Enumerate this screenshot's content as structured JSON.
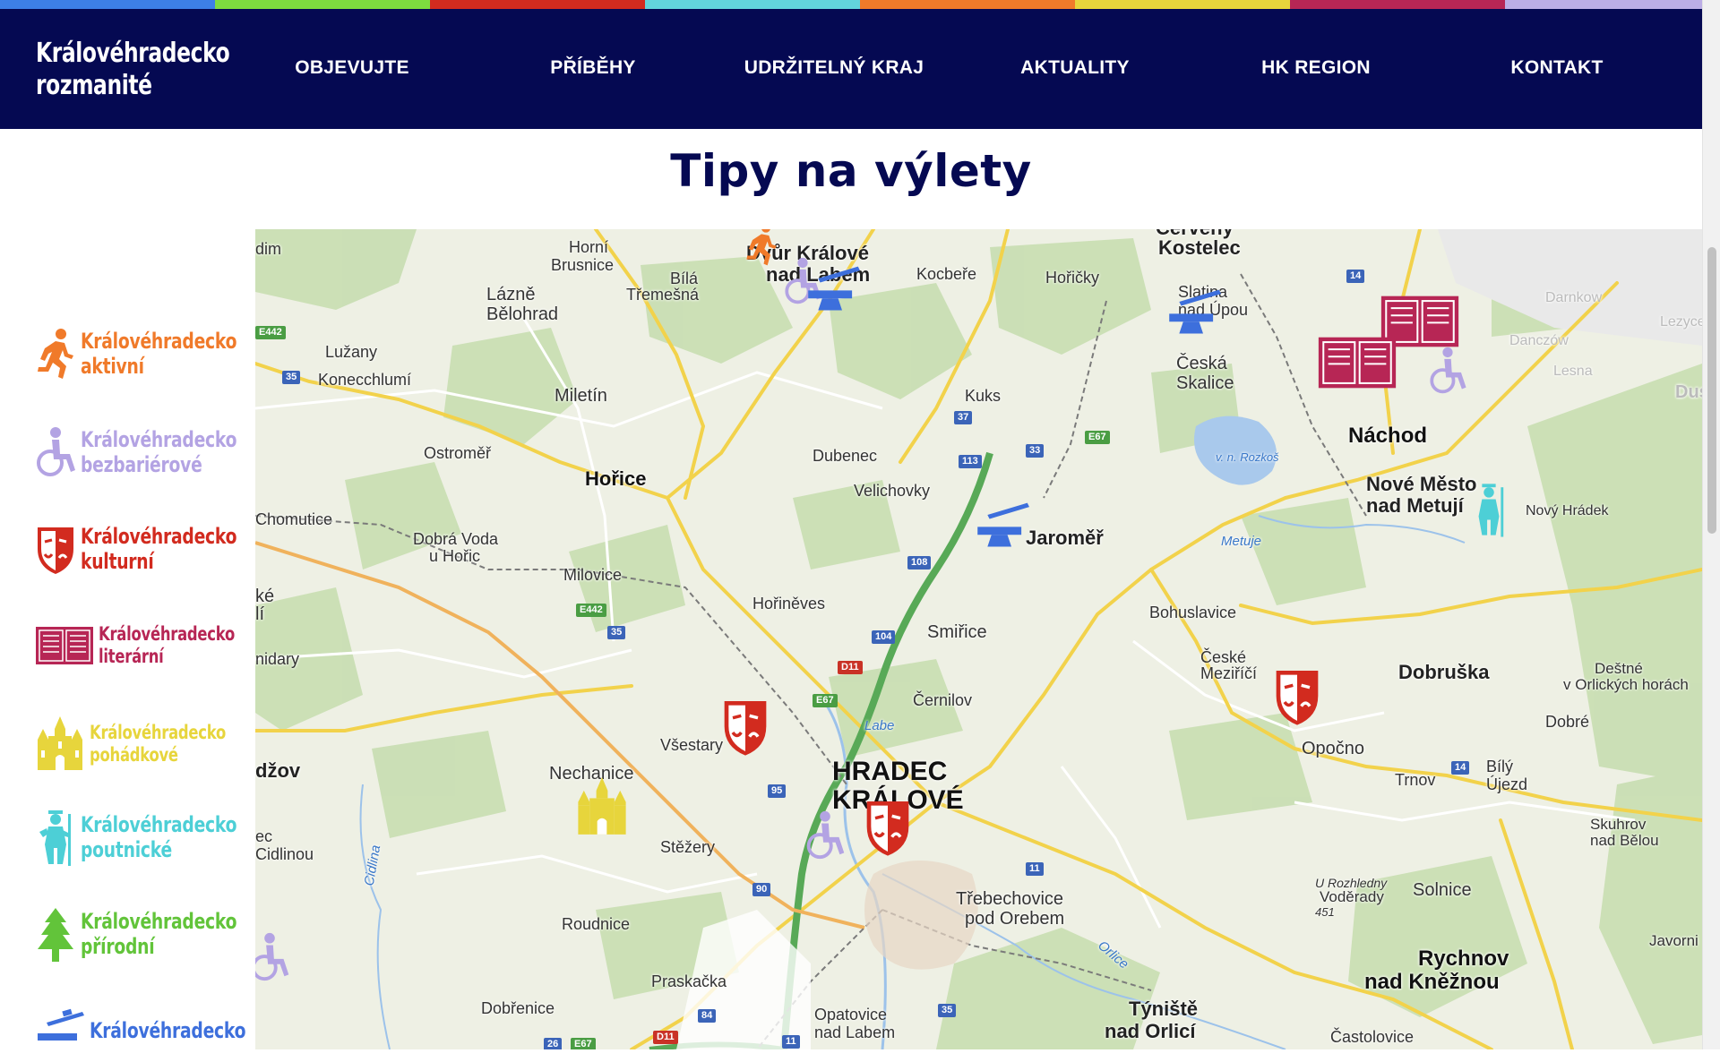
{
  "color_strip": [
    "#3d7fe6",
    "#7ddc3f",
    "#d22b1f",
    "#62d4dc",
    "#f07a2a",
    "#e7d53c",
    "#b72655",
    "#bcaee6"
  ],
  "logo": {
    "line1": "Královéhradecko",
    "line2": "rozmanité"
  },
  "nav": [
    {
      "label": "OBJEVUJTE"
    },
    {
      "label": "PŘÍBĚHY"
    },
    {
      "label": "UDRŽITELNÝ KRAJ"
    },
    {
      "label": "AKTUALITY"
    },
    {
      "label": "HK REGION"
    },
    {
      "label": "KONTAKT"
    }
  ],
  "page_title": "Tipy na výlety",
  "categories": [
    {
      "line1": "Královéhradecko",
      "line2": "aktivní",
      "color": "#f07a2a",
      "icon": "runner-icon"
    },
    {
      "line1": "Královéhradecko",
      "line2": "bezbariérové",
      "color": "#b3a3e3",
      "icon": "wheelchair-icon"
    },
    {
      "line1": "Královéhradecko",
      "line2": "kulturní",
      "color": "#d22b1f",
      "icon": "theatre-mask-icon"
    },
    {
      "line1": "Královéhradecko",
      "line2": "literární",
      "color": "#b72655",
      "icon": "open-book-icon"
    },
    {
      "line1": "Královéhradecko",
      "line2": "pohádkové",
      "color": "#e7d53c",
      "icon": "castle-icon"
    },
    {
      "line1": "Královéhradecko",
      "line2": "poutnické",
      "color": "#4dcfd6",
      "icon": "pilgrim-icon"
    },
    {
      "line1": "Královéhradecko",
      "line2": "přírodní",
      "color": "#62c43a",
      "icon": "tree-icon"
    },
    {
      "line1": "Královéhradecko",
      "line2": "",
      "color": "#3d6fdc",
      "icon": "anvil-icon"
    }
  ],
  "map": {
    "places": [
      {
        "t": "dim"
      },
      {
        "t": "Horní"
      },
      {
        "t": "Brusnice"
      },
      {
        "t": "Lázně"
      },
      {
        "t": "Bělohrad"
      },
      {
        "t": "Bílá"
      },
      {
        "t": "Třemešná"
      },
      {
        "t": "Dvůr Králové"
      },
      {
        "t": "nad Labem"
      },
      {
        "t": "Kocbeře"
      },
      {
        "t": "Červený"
      },
      {
        "t": "Kostelec"
      },
      {
        "t": "Hořičky"
      },
      {
        "t": "Slatina"
      },
      {
        "t": "nad Úpou"
      },
      {
        "t": "Česká"
      },
      {
        "t": "Skalice"
      },
      {
        "t": "Lužany"
      },
      {
        "t": "Konecchlumí"
      },
      {
        "t": "Miletín"
      },
      {
        "t": "Kuks"
      },
      {
        "t": "Náchod"
      },
      {
        "t": "Ostroměř"
      },
      {
        "t": "Dubenec"
      },
      {
        "t": "Hořice"
      },
      {
        "t": "Velichovky"
      },
      {
        "t": "Nové Město"
      },
      {
        "t": "nad Metují"
      },
      {
        "t": "Nový Hrádek"
      },
      {
        "t": "Chomutice"
      },
      {
        "t": "Dobrá Voda"
      },
      {
        "t": "u Hořic"
      },
      {
        "t": "Jaroměř"
      },
      {
        "t": "Milovice"
      },
      {
        "t": "Hořiněves"
      },
      {
        "t": "Bohuslavice"
      },
      {
        "t": "ké"
      },
      {
        "t": "lí"
      },
      {
        "t": "Smiřice"
      },
      {
        "t": "České"
      },
      {
        "t": "Meziříčí"
      },
      {
        "t": "Dobruška"
      },
      {
        "t": "Deštné"
      },
      {
        "t": "v Orlických horách"
      },
      {
        "t": "nidary"
      },
      {
        "t": "Černilov"
      },
      {
        "t": "Dobré"
      },
      {
        "t": "Všestary"
      },
      {
        "t": "Opočno"
      },
      {
        "t": "džov"
      },
      {
        "t": "Nechanice"
      },
      {
        "t": "HRADEC"
      },
      {
        "t": "KRÁLOVÉ"
      },
      {
        "t": "Trnov"
      },
      {
        "t": "Bílý"
      },
      {
        "t": "Újezd"
      },
      {
        "t": "ec"
      },
      {
        "t": "Cidlinou"
      },
      {
        "t": "Stěžery"
      },
      {
        "t": "Skuhrov"
      },
      {
        "t": "nad Bělou"
      },
      {
        "t": "U Rozhledny"
      },
      {
        "t": "Voděrady"
      },
      {
        "t": "451"
      },
      {
        "t": "Třebechovice"
      },
      {
        "t": "pod Orebem"
      },
      {
        "t": "Solnice"
      },
      {
        "t": "Roudnice"
      },
      {
        "t": "Rychnov"
      },
      {
        "t": "nad Kněžnou"
      },
      {
        "t": "Javorni"
      },
      {
        "t": "Praskačka"
      },
      {
        "t": "Dobřenice"
      },
      {
        "t": "Opatovice"
      },
      {
        "t": "nad Labem"
      },
      {
        "t": "Týniště"
      },
      {
        "t": "nad Orlicí"
      },
      {
        "t": "Častolovice"
      },
      {
        "t": "Darnkow"
      },
      {
        "t": "Lezyce"
      },
      {
        "t": "Danczów"
      },
      {
        "t": "Lesna"
      },
      {
        "t": "Dusz"
      }
    ],
    "water": [
      "v. n. Rozkoš",
      "Metuje",
      "Labe",
      "Orlice",
      "Cidlina"
    ],
    "road_labels": [
      "E442",
      "35",
      "37",
      "33",
      "E67",
      "113",
      "108",
      "104",
      "D11",
      "E67",
      "E442",
      "35",
      "95",
      "90",
      "11",
      "14",
      "14",
      "84",
      "11",
      "35",
      "E67",
      "26",
      "D11"
    ]
  }
}
